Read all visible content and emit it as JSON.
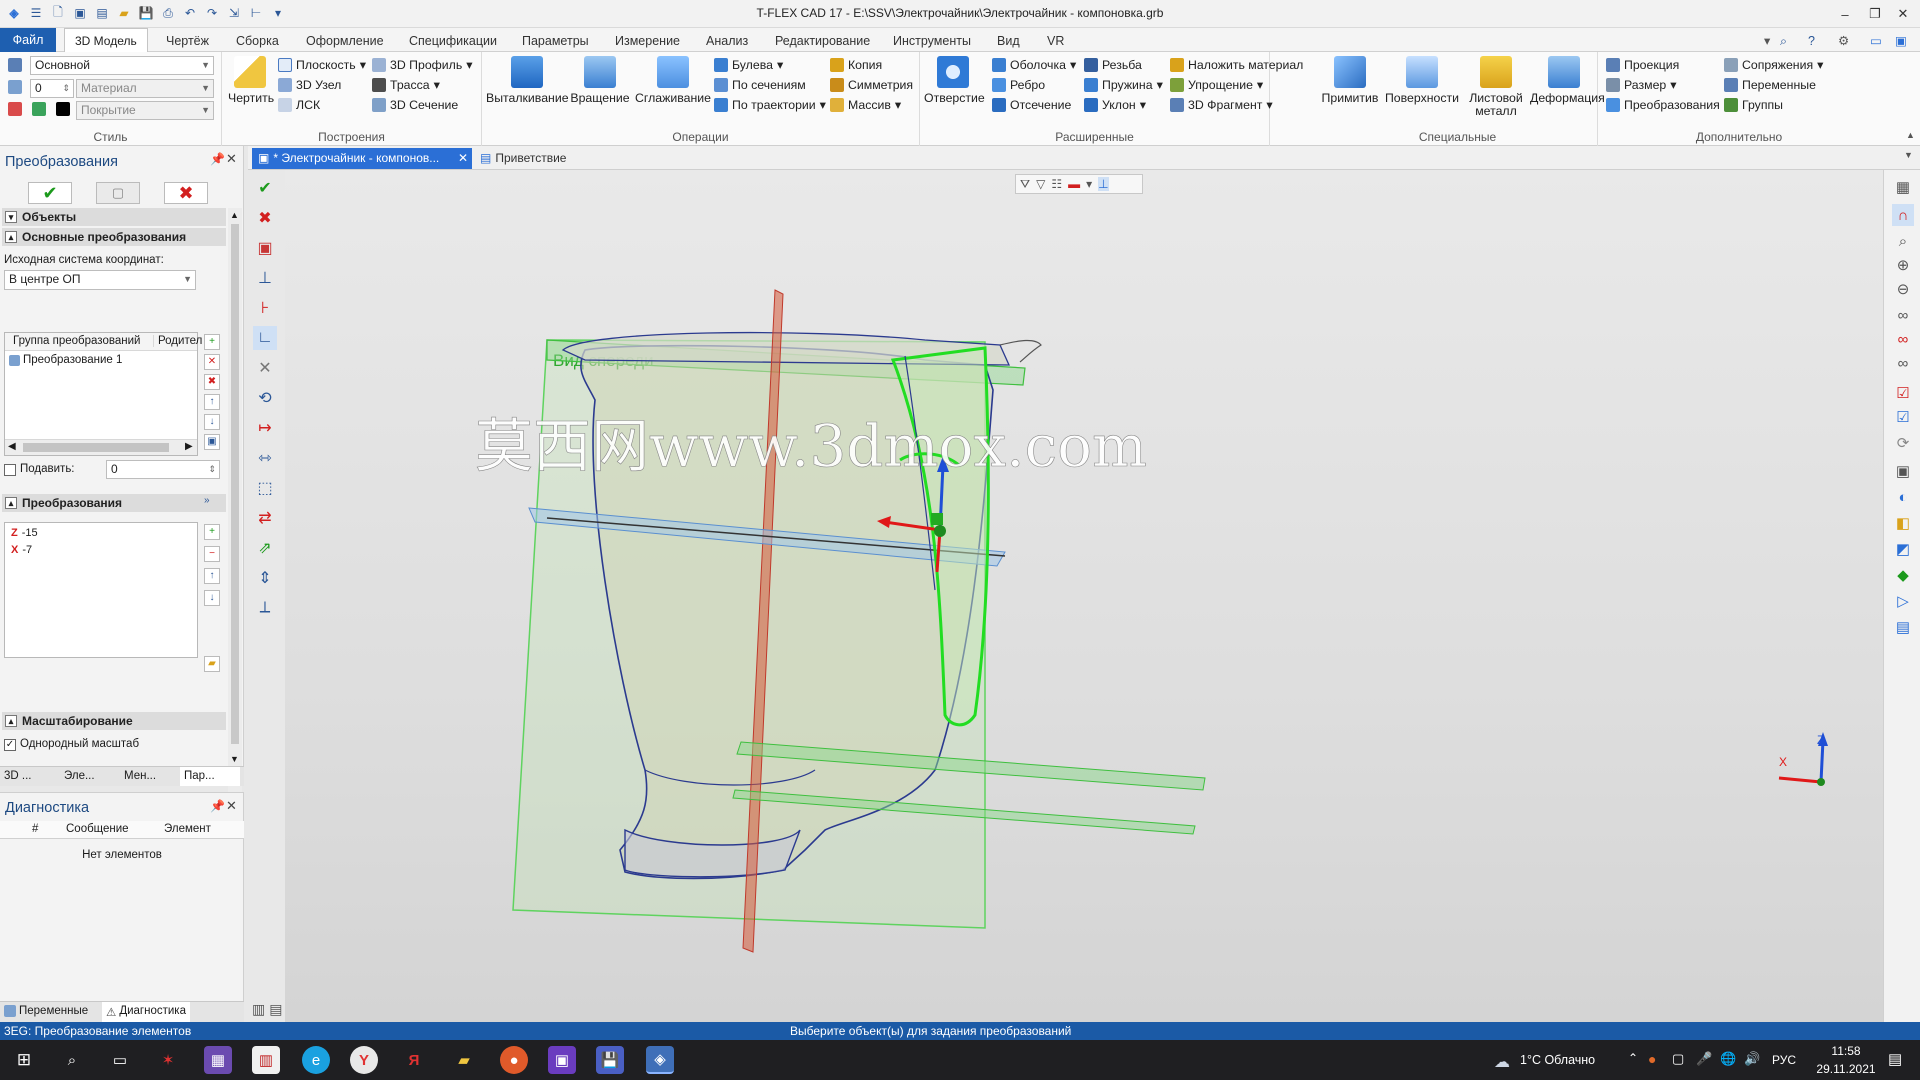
{
  "title_bar": {
    "title": "T-FLEX CAD 17 - E:\\SSV\\Электрочайник\\Электрочайник - компоновка.grb",
    "quick_access_icons": [
      "menu-icon",
      "new-file-icon",
      "open-icon",
      "window-icon",
      "save-icon",
      "print-icon",
      "undo-icon",
      "redo-icon",
      "export-icon",
      "measure-icon",
      "dropdown-icon"
    ]
  },
  "menu": {
    "file": "Файл",
    "tabs": [
      "3D Модель",
      "Чертёж",
      "Сборка",
      "Оформление",
      "Спецификации",
      "Параметры",
      "Измерение",
      "Анализ",
      "Редактирование",
      "Инструменты",
      "Вид",
      "VR"
    ]
  },
  "ribbon": {
    "style": {
      "label": "Стиль",
      "layer": "Основной",
      "level": "0",
      "material_placeholder": "Материал",
      "coating_placeholder": "Покрытие"
    },
    "constructions": {
      "label": "Построения",
      "draw": "Чертить",
      "plane": "Плоскость",
      "node3d": "3D Узел",
      "lcs": "ЛСК",
      "profile3d": "3D Профиль",
      "path": "Трасса",
      "section3d": "3D Сечение"
    },
    "operations": {
      "label": "Операции",
      "extrude": "Выталкивание",
      "rotate": "Вращение",
      "smooth": "Сглаживание",
      "boolean": "Булева",
      "by_sections": "По сечениям",
      "by_path": "По траектории",
      "copy": "Копия",
      "symmetry": "Симметрия",
      "array": "Массив"
    },
    "extended": {
      "label": "Расширенные",
      "hole": "Отверстие",
      "shell": "Оболочка",
      "rib": "Ребро",
      "cutoff": "Отсечение",
      "thread": "Резьба",
      "spring": "Пружина",
      "slope": "Уклон",
      "apply_material": "Наложить материал",
      "simplify": "Упрощение",
      "fragment3d": "3D Фрагмент"
    },
    "special": {
      "label": "Специальные",
      "primitives": "Примитив",
      "surfaces": "Поверхности",
      "sheet_metal": "Листовой металл",
      "deformation": "Деформация"
    },
    "extra": {
      "label": "Дополнительно",
      "projection": "Проекция",
      "size": "Размер",
      "transform": "Преобразования",
      "mates": "Сопряжения",
      "variables": "Переменные",
      "groups": "Группы"
    }
  },
  "left_panel": {
    "title": "Преобразования",
    "objects": "Объекты",
    "basic_transforms": "Основные преобразования",
    "source_cs_label": "Исходная система координат:",
    "source_cs_value": "В центре ОП",
    "table_headers": [
      "Группа преобразований",
      "Родител"
    ],
    "table_rows": [
      "Преобразование 1"
    ],
    "suppress_label": "Подавить:",
    "suppress_value": "0",
    "transforms_header": "Преобразования",
    "transforms": [
      {
        "axis": "Z",
        "value": "-15"
      },
      {
        "axis": "X",
        "value": "-7"
      }
    ],
    "scaling_header": "Масштабирование",
    "uniform_scale": "Однородный масштаб",
    "bottom_tabs": [
      "3D ...",
      "Эле...",
      "Мен...",
      "Пар..."
    ]
  },
  "diagnostics": {
    "title": "Диагностика",
    "headers": [
      "#",
      "Сообщение",
      "Элемент"
    ],
    "empty": "Нет элементов",
    "bottom_tabs": [
      "Переменные",
      "Диагностика"
    ]
  },
  "doc_tabs": [
    "* Электрочайник - компонов...",
    "Приветствие"
  ],
  "viewport": {
    "plane_label": "Вид спереди",
    "watermark": "莫西网www.3dmox.com",
    "axis_z": "Z",
    "axis_x": "X"
  },
  "status": {
    "left": "3EG: Преобразование элементов",
    "center": "Выберите объект(ы) для задания преобразований"
  },
  "taskbar": {
    "weather": "1°C Облачно",
    "lang": "РУС",
    "time": "11:58",
    "date": "29.11.2021"
  },
  "colors": {
    "accent": "#1e5fb0",
    "plane_green": "#5fd35f",
    "selection_green": "#22dd22",
    "status_blue": "#1b5aa6"
  }
}
